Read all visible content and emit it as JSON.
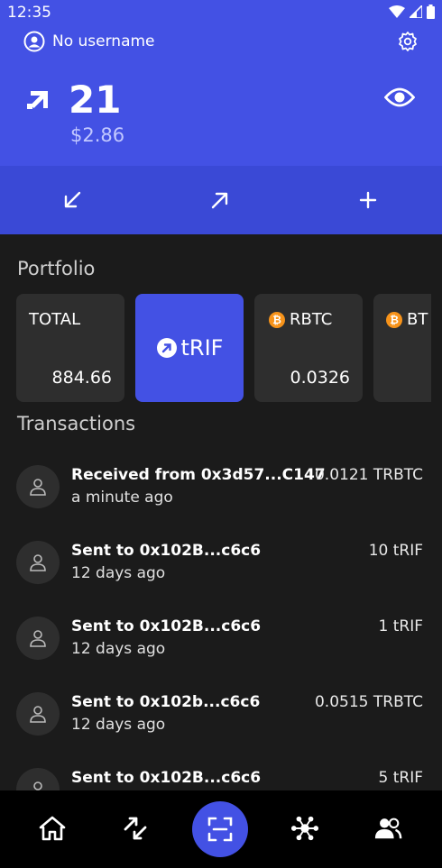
{
  "status_bar": {
    "time": "12:35"
  },
  "header": {
    "username": "No username",
    "balance": "21",
    "balance_usd": "$2.86",
    "icons": [
      "user-circle-icon",
      "gear-icon",
      "rif-logo-icon",
      "eye-icon"
    ]
  },
  "actions": {
    "receive_icon": "arrow-down-left-icon",
    "send_icon": "arrow-up-right-icon",
    "add_icon": "plus-icon"
  },
  "portfolio": {
    "title": "Portfolio",
    "cards": [
      {
        "label": "TOTAL",
        "value": "884.66"
      },
      {
        "label": "tRIF",
        "value": ""
      },
      {
        "label": "RBTC",
        "value": "0.0326"
      },
      {
        "label": "BT",
        "value": ""
      }
    ]
  },
  "transactions": {
    "title": "Transactions",
    "items": [
      {
        "title": "Received from 0x3d57...C147",
        "time": "a minute ago",
        "amount": "0.0121 TRBTC"
      },
      {
        "title": "Sent to 0x102B...c6c6",
        "time": "12 days ago",
        "amount": "10 tRIF"
      },
      {
        "title": "Sent to 0x102B...c6c6",
        "time": "12 days ago",
        "amount": "1 tRIF"
      },
      {
        "title": "Sent to 0x102b...c6c6",
        "time": "12 days ago",
        "amount": "0.0515 TRBTC"
      },
      {
        "title": "Sent to 0x102B...c6c6",
        "time": "",
        "amount": "5 tRIF"
      }
    ]
  },
  "bottom_nav": [
    "home-icon",
    "swap-icon",
    "scan-icon",
    "network-icon",
    "contacts-icon"
  ],
  "colors": {
    "accent": "#4351e4",
    "background": "#1b1b1b",
    "card": "#2e2e2e",
    "bitcoin": "#f7931a"
  }
}
